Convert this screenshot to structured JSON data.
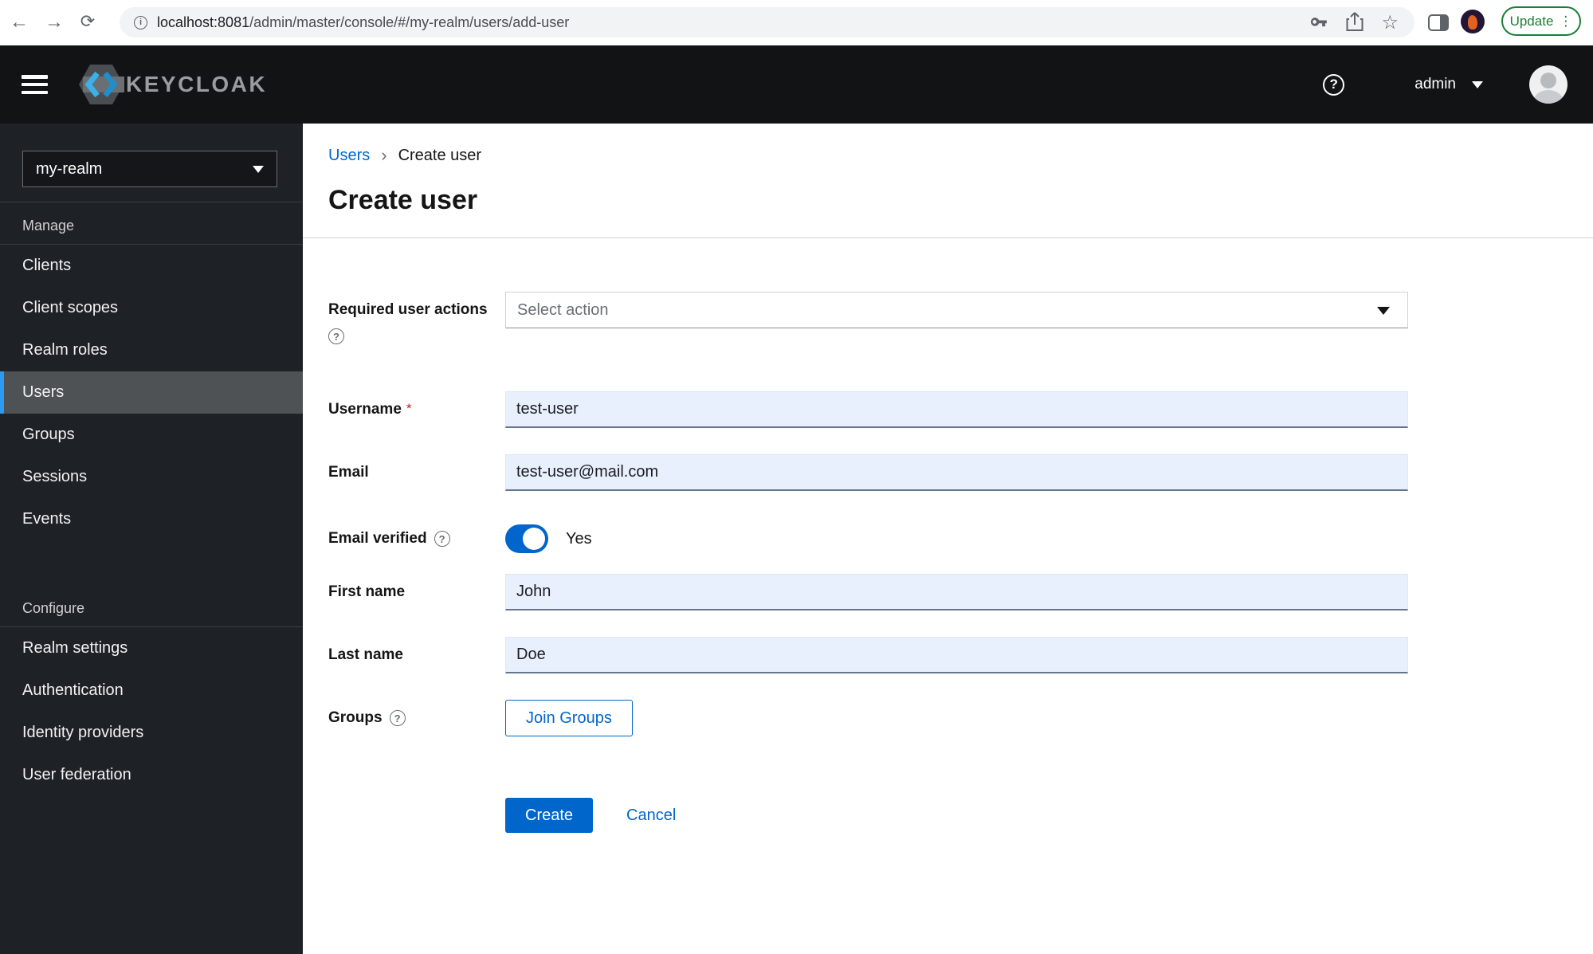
{
  "browser": {
    "url_host": "localhost:8081",
    "url_path": "/admin/master/console/#/my-realm/users/add-user",
    "update_label": "Update",
    "kebab": "⋮"
  },
  "header": {
    "brand": "KEYCLOAK",
    "user": "admin",
    "help_glyph": "?"
  },
  "sidebar": {
    "realm": "my-realm",
    "manage": {
      "title": "Manage",
      "items": [
        "Clients",
        "Client scopes",
        "Realm roles",
        "Users",
        "Groups",
        "Sessions",
        "Events"
      ]
    },
    "configure": {
      "title": "Configure",
      "items": [
        "Realm settings",
        "Authentication",
        "Identity providers",
        "User federation"
      ]
    },
    "active_item": "Users"
  },
  "main": {
    "breadcrumb": {
      "parent": "Users",
      "separator": "›",
      "current": "Create user"
    },
    "title": "Create user",
    "form": {
      "required_actions": {
        "label": "Required user actions",
        "placeholder": "Select action"
      },
      "username": {
        "label": "Username",
        "required_mark": "*",
        "value": "test-user"
      },
      "email": {
        "label": "Email",
        "value": "test-user@mail.com"
      },
      "email_verified": {
        "label": "Email verified",
        "value": "Yes"
      },
      "first_name": {
        "label": "First name",
        "value": "John"
      },
      "last_name": {
        "label": "Last name",
        "value": "Doe"
      },
      "groups": {
        "label": "Groups",
        "button_label": "Join Groups"
      }
    },
    "actions": {
      "create": "Create",
      "cancel": "Cancel"
    },
    "help_glyph": "?"
  },
  "colors": {
    "accent_blue": "#0066cc",
    "nav_active_accent": "#2b9af3",
    "update_green": "#1a7f37",
    "required_red": "#c9190b",
    "masthead_bg": "#111315",
    "sidebar_bg": "#1e2125",
    "autofill_input_bg": "#e8f0fe"
  }
}
